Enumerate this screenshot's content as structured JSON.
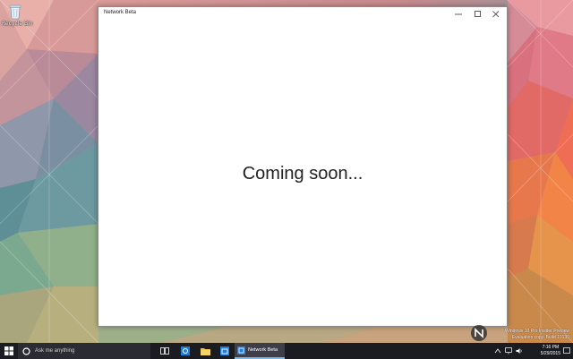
{
  "desktop": {
    "icon_label": "Recycle Bin"
  },
  "window": {
    "title": "Network Beta",
    "message": "Coming soon...",
    "min_icon": "minimize-icon",
    "max_icon": "maximize-icon",
    "close_icon": "close-icon"
  },
  "watermark": {
    "line1": "Windows 10 Pro Insider Preview",
    "line2": "Evaluation copy. Build 10130"
  },
  "taskbar": {
    "search_placeholder": "Ask me anything",
    "active_app_label": "Network Beta",
    "time": "7:16 PM",
    "date": "5/29/2015",
    "accent_color": "#76b9ed"
  }
}
